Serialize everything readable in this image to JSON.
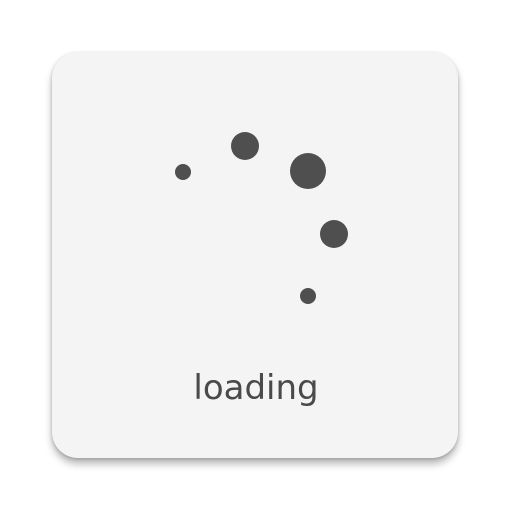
{
  "icon": {
    "caption": "loading",
    "background_color": "#f4f4f4",
    "dot_color": "#4f4f4f",
    "spinner_icon": "loading-spinner-icon"
  }
}
